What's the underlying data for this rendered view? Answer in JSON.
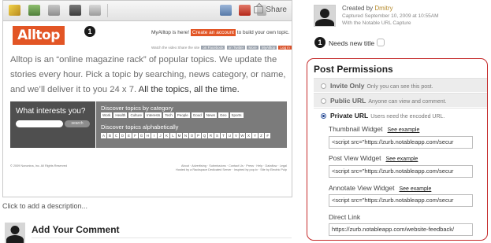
{
  "screenshot": {
    "toolbar": {
      "icons": [
        "pencil-icon",
        "image-icon",
        "download-icon",
        "binoculars-icon",
        "trash-icon",
        "folder-icon",
        "pdf-icon",
        "mail-icon"
      ],
      "share_label": "Share"
    },
    "logo_text": "Alltop",
    "step_number": "1",
    "myalltop": {
      "prefix": "MyAlltop is here!",
      "button": "Create an account",
      "suffix": "to build your own topic."
    },
    "social": {
      "watch": "Watch the video",
      "share": "Share the site",
      "facebook": "on Facebook",
      "twitter": "on Twitter",
      "more": "More",
      "myalltop": "MyAlltop",
      "login": "Log in"
    },
    "intro_text": "Alltop is an “online magazine rack” of popular topics. We update the stories every hour. Pick a topic by searching, news category, or name, and we’ll deliver it to you 24 x 7.",
    "intro_emphasis": "All the topics, all the time.",
    "search_box": {
      "title": "What interests you?",
      "button": "search"
    },
    "discover": {
      "by_category_title": "Discover topics by category",
      "categories": [
        "Work",
        "Health",
        "Culture",
        "Interests",
        "Tech",
        "People",
        "Good",
        "News",
        "Geo",
        "Sports"
      ],
      "alpha_title": "Discover topics alphabetically",
      "letters": [
        "A",
        "B",
        "C",
        "D",
        "E",
        "F",
        "G",
        "H",
        "I",
        "J",
        "K",
        "L",
        "M",
        "N",
        "O",
        "P",
        "Q",
        "R",
        "S",
        "T",
        "U",
        "V",
        "W",
        "X",
        "Y",
        "Z",
        "#"
      ]
    },
    "copyright": "© 2009 Nononina, Inc. All Rights Reserved",
    "footer_links": "About · Advertising · Submissions · Contact Us · Press · Help · Dataflow · Legal",
    "footer_hosted": "Hosted by a Rackspace Dedicated Server · Inspired by pop.tv · Site by Electric Pulp"
  },
  "description_prompt": "Click to add a description...",
  "comment_heading": "Add Your Comment",
  "capture": {
    "created_prefix": "Created by",
    "created_by": "Dmitry",
    "captured_line": "Captured September 10, 2009 at 10:55AM",
    "tool_line": "With the Notable URL Capture"
  },
  "needs_title": {
    "step": "1",
    "label": "Needs new title"
  },
  "permissions": {
    "title": "Post Permissions",
    "options": [
      {
        "name": "Invite Only",
        "description": "Only you can see this post.",
        "selected": false
      },
      {
        "name": "Public URL",
        "description": "Anyone can view and comment.",
        "selected": false
      },
      {
        "name": "Private URL",
        "description": "Users need the encoded URL.",
        "selected": true
      }
    ],
    "see_example": "See example",
    "widgets": [
      {
        "label": "Thumbnail Widget",
        "value": "<script src=\"https://zurb.notableapp.com/secur"
      },
      {
        "label": "Post View Widget",
        "value": "<script src=\"https://zurb.notableapp.com/secur"
      },
      {
        "label": "Annotate View Widget",
        "value": "<script src=\"https://zurb.notableapp.com/secur"
      }
    ],
    "direct_link_label": "Direct Link",
    "direct_link_value": "https://zurb.notableapp.com/website-feedback/"
  },
  "colors": {
    "accent_orange": "#e25525",
    "permission_border": "#c52b2b",
    "creator_name": "#b58a2c"
  }
}
